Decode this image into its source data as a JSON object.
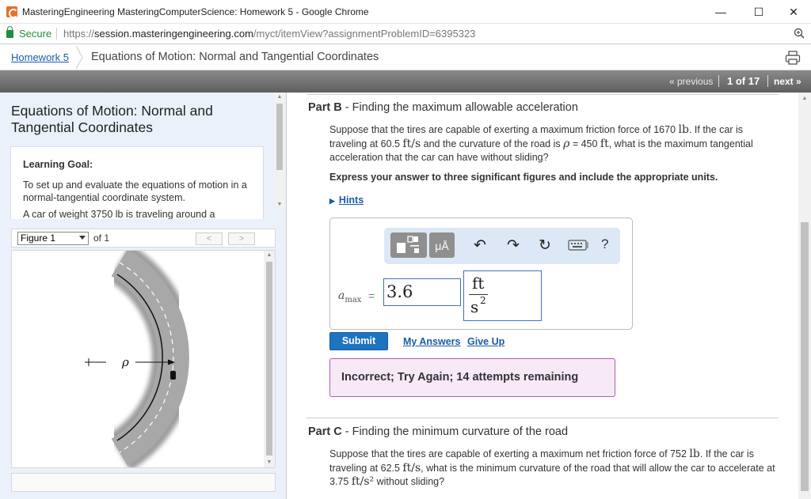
{
  "window": {
    "title": "MasteringEngineering MasteringComputerScience: Homework 5 - Google Chrome",
    "minimize": "—",
    "maximize": "☐",
    "close": "✕"
  },
  "address": {
    "secure_label": "Secure",
    "url_scheme": "https://",
    "url_host": "session.masteringengineering.com",
    "url_path": "/myct/itemView?assignmentProblemID=6395323"
  },
  "breadcrumb": {
    "home": "Homework 5",
    "title": "Equations of Motion: Normal and Tangential Coordinates"
  },
  "nav": {
    "previous": "« previous",
    "page": "1 of 17",
    "next": "next »"
  },
  "intro": {
    "title": "Equations of Motion: Normal and Tangential Coordinates",
    "goal_heading": "Learning Goal:",
    "goal_text": "To set up and evaluate the equations of motion in a normal-tangential coordinate system.",
    "goal_cut_text": "A car of weight 3750 lb is traveling around a"
  },
  "figure": {
    "selected": "Figure 1",
    "of_label": "of 1",
    "prev": "<",
    "next": ">",
    "rho_label": "ρ"
  },
  "partB": {
    "label": "Part B",
    "title": " - Finding the maximum allowable acceleration",
    "text_1": "Suppose that the tires are capable of exerting a maximum friction force of 1670 ",
    "unit_force": "lb",
    "text_2": ". If the car is traveling at 60.5 ",
    "unit_speed": "ft/s",
    "text_3": " and the curvature of the road is ",
    "rho_symbol": "ρ",
    "text_4": " = 450 ",
    "unit_length": "ft",
    "text_5": ", what is the maximum tangential acceleration that the car can have without sliding?",
    "instruction": "Express your answer to three significant figures and include the appropriate units.",
    "hints": "Hints",
    "units_btn": "μÅ",
    "help": "?",
    "answer_symbol": "a",
    "answer_sub": "max",
    "equals": "=",
    "answer_value": "3.6",
    "unit_num": "ft",
    "unit_den": "s",
    "unit_exp": "2",
    "submit": "Submit",
    "my_answers": "My Answers",
    "give_up": "Give Up",
    "feedback": "Incorrect; Try Again; 14 attempts remaining"
  },
  "partC": {
    "label": "Part C",
    "title": " - Finding the minimum curvature of the road",
    "text_1": "Suppose that the tires are capable of exerting a maximum net friction force of 752 ",
    "unit_force": "lb",
    "text_2": ". If the car is traveling at 62.5 ",
    "unit_speed": "ft/s",
    "text_3": ", what is the minimum curvature of the road that will allow the car to accelerate at 3.75 ",
    "unit_accel": "ft/s²",
    "text_4": " without sliding?"
  },
  "colors": {
    "link": "#1a5ca8",
    "submit": "#1e73be",
    "feedback_bg": "#f7e9f6",
    "feedback_border": "#b35bb0"
  }
}
